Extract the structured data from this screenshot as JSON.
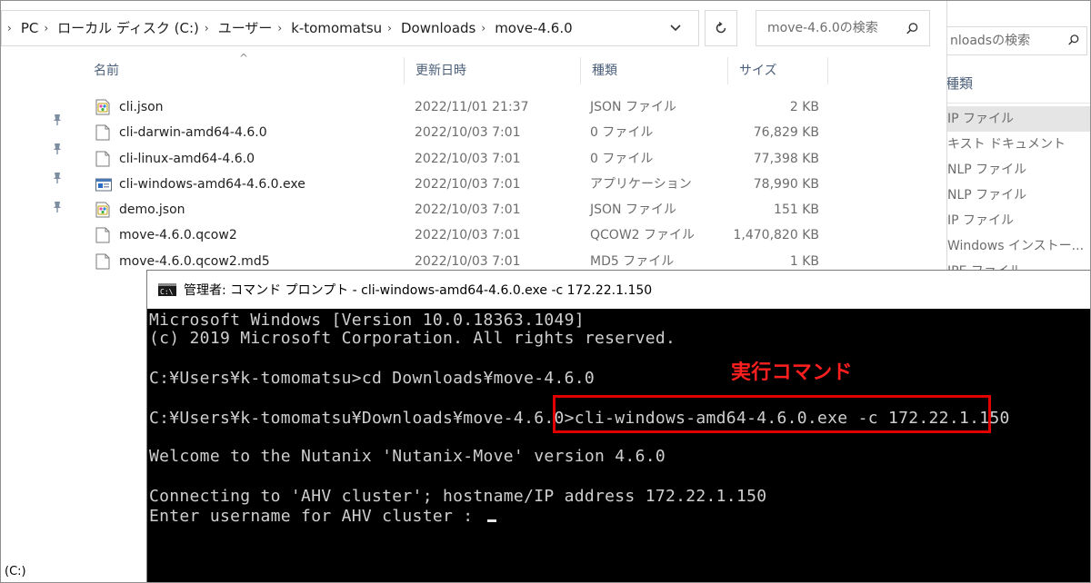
{
  "explorer": {
    "breadcrumbs": [
      "PC",
      "ローカル ディスク (C:)",
      "ユーザー",
      "k-tomomatsu",
      "Downloads",
      "move-4.6.0"
    ],
    "search_placeholder": "move-4.6.0の検索",
    "columns": {
      "name": "名前",
      "date": "更新日時",
      "type": "種類",
      "size": "サイズ"
    },
    "files": [
      {
        "name": "cli.json",
        "date": "2022/11/01 21:37",
        "type": "JSON ファイル",
        "size": "2 KB",
        "icon": "json-file-icon"
      },
      {
        "name": "cli-darwin-amd64-4.6.0",
        "date": "2022/10/03 7:01",
        "type": "0 ファイル",
        "size": "76,829 KB",
        "icon": "file-icon"
      },
      {
        "name": "cli-linux-amd64-4.6.0",
        "date": "2022/10/03 7:01",
        "type": "0 ファイル",
        "size": "77,398 KB",
        "icon": "file-icon"
      },
      {
        "name": "cli-windows-amd64-4.6.0.exe",
        "date": "2022/10/03 7:01",
        "type": "アプリケーション",
        "size": "78,990 KB",
        "icon": "exe-file-icon"
      },
      {
        "name": "demo.json",
        "date": "2022/10/03 7:01",
        "type": "JSON ファイル",
        "size": "151 KB",
        "icon": "json-file-icon"
      },
      {
        "name": "move-4.6.0.qcow2",
        "date": "2022/10/03 7:01",
        "type": "QCOW2 ファイル",
        "size": "1,470,820 KB",
        "icon": "file-icon"
      },
      {
        "name": "move-4.6.0.qcow2.md5",
        "date": "2022/10/03 7:01",
        "type": "MD5 ファイル",
        "size": "1 KB",
        "icon": "file-icon"
      }
    ],
    "status": "(C:)"
  },
  "back_explorer": {
    "search_placeholder": "nloadsの検索",
    "column_header": "種類",
    "types": [
      "IP ファイル",
      "キスト ドキュメント",
      "NLP ファイル",
      "NLP ファイル",
      "IP ファイル",
      "Windows インストー...",
      "IPE ファイル"
    ],
    "selected_index": 0
  },
  "cmd": {
    "title": "管理者: コマンド プロンプト - cli-windows-amd64-4.6.0.exe  -c 172.22.1.150",
    "lines": [
      "Microsoft Windows [Version 10.0.18363.1049]",
      "(c) 2019 Microsoft Corporation. All rights reserved.",
      "",
      "C:¥Users¥k-tomomatsu>cd Downloads¥move-4.6.0",
      "",
      "C:¥Users¥k-tomomatsu¥Downloads¥move-4.6.0>cli-windows-amd64-4.6.0.exe -c 172.22.1.150",
      "",
      "Welcome to the Nutanix 'Nutanix-Move' version 4.6.0",
      "",
      "Connecting to 'AHV cluster'; hostname/IP address 172.22.1.150",
      "Enter username for AHV cluster : "
    ],
    "annotation": "実行コマンド",
    "annotation_color": "#ff1f1f"
  }
}
